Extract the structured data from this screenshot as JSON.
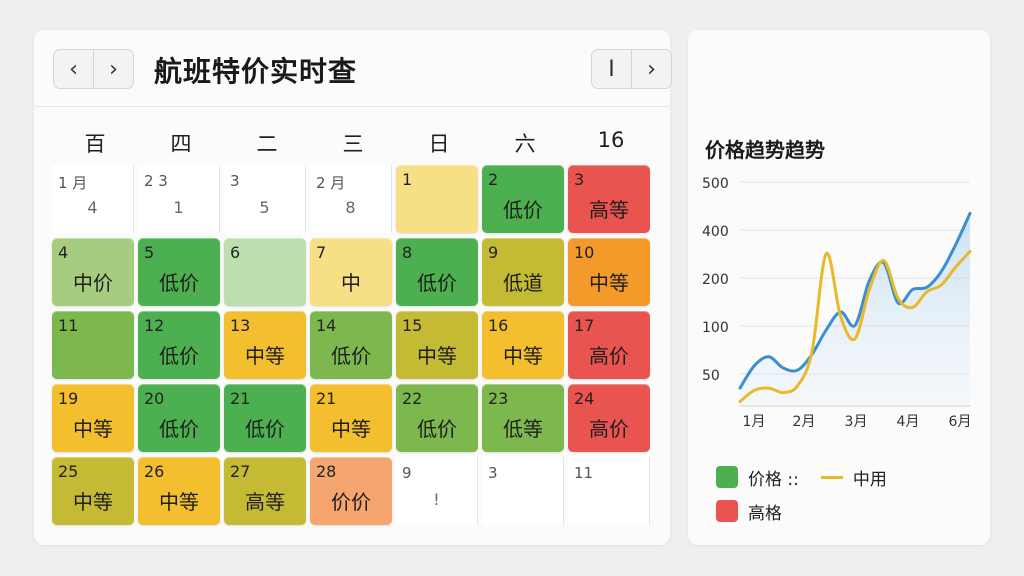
{
  "header": {
    "title": "航班特价实时查",
    "prev_glyph": "‹",
    "next_glyph": "›",
    "right_first_glyph": "I",
    "right_next_glyph": "›"
  },
  "weekdays": [
    "百",
    "四",
    "二",
    "三",
    "日",
    "六",
    "16"
  ],
  "calendar": {
    "rows": [
      [
        {
          "type": "blank",
          "num": "1   月",
          "sub": "4"
        },
        {
          "type": "blank",
          "num": "2   3",
          "sub": "1"
        },
        {
          "type": "blank",
          "num": "3",
          "sub": "5"
        },
        {
          "type": "blank",
          "num": "2   月",
          "sub": "8"
        },
        {
          "type": "cell",
          "num": "1",
          "label": "",
          "color": "paleyellow"
        },
        {
          "type": "cell",
          "num": "2",
          "label": "低价",
          "color": "green"
        },
        {
          "type": "cell",
          "num": "3",
          "label": "高等",
          "color": "red"
        }
      ],
      [
        {
          "type": "cell",
          "num": "4",
          "label": "中价",
          "color": "lightgreen"
        },
        {
          "type": "cell",
          "num": "5",
          "label": "低价",
          "color": "green"
        },
        {
          "type": "cell",
          "num": "6",
          "label": "",
          "color": "palegreen"
        },
        {
          "type": "cell",
          "num": "7",
          "label": "中",
          "color": "paleyellow"
        },
        {
          "type": "cell",
          "num": "8",
          "label": "低价",
          "color": "green"
        },
        {
          "type": "cell",
          "num": "9",
          "label": "低道",
          "color": "olive"
        },
        {
          "type": "cell",
          "num": "10",
          "label": "中等",
          "color": "orange"
        }
      ],
      [
        {
          "type": "cell",
          "num": "11",
          "label": "",
          "color": "mossgreen"
        },
        {
          "type": "cell",
          "num": "12",
          "label": "低价",
          "color": "green"
        },
        {
          "type": "cell",
          "num": "13",
          "label": "中等",
          "color": "yellow"
        },
        {
          "type": "cell",
          "num": "14",
          "label": "低价",
          "color": "mossgreen"
        },
        {
          "type": "cell",
          "num": "15",
          "label": "中等",
          "color": "olive"
        },
        {
          "type": "cell",
          "num": "16",
          "label": "中等",
          "color": "yellow"
        },
        {
          "type": "cell",
          "num": "17",
          "label": "高价",
          "color": "red"
        }
      ],
      [
        {
          "type": "cell",
          "num": "19",
          "label": "中等",
          "color": "yellow"
        },
        {
          "type": "cell",
          "num": "20",
          "label": "低价",
          "color": "green"
        },
        {
          "type": "cell",
          "num": "21",
          "label": "低价",
          "color": "green"
        },
        {
          "type": "cell",
          "num": "21",
          "label": "中等",
          "color": "yellow"
        },
        {
          "type": "cell",
          "num": "22",
          "label": "低价",
          "color": "mossgreen"
        },
        {
          "type": "cell",
          "num": "23",
          "label": "低等",
          "color": "mossgreen"
        },
        {
          "type": "cell",
          "num": "24",
          "label": "高价",
          "color": "red"
        }
      ],
      [
        {
          "type": "cell",
          "num": "25",
          "label": "中等",
          "color": "olive"
        },
        {
          "type": "cell",
          "num": "26",
          "label": "中等",
          "color": "yellow"
        },
        {
          "type": "cell",
          "num": "27",
          "label": "高等",
          "color": "olive"
        },
        {
          "type": "cell",
          "num": "28",
          "label": "价价",
          "color": "peach"
        },
        {
          "type": "blank",
          "num": "9",
          "sub": "!"
        },
        {
          "type": "blank",
          "num": "3",
          "sub": ""
        },
        {
          "type": "blank",
          "num": "11",
          "sub": ""
        }
      ]
    ]
  },
  "colors": {
    "lightgreen": "#a6cd7f",
    "green": "#4caf50",
    "mossgreen": "#7cb84e",
    "palegreen": "#bddfaf",
    "paleyellow": "#f7df86",
    "yellow": "#f4bf2f",
    "olive": "#c4ba34",
    "orange": "#f49a2a",
    "red": "#ea5450",
    "peach": "#f5a66e",
    "series_blue": "#3b8fd0",
    "series_yellow": "#e9b92a"
  },
  "chart_title": "价格趋势趋势",
  "chart_data": {
    "type": "line",
    "title": "价格趋势趋势",
    "y_ticks": [
      "500",
      "400",
      "200",
      "100",
      "50"
    ],
    "categories": [
      "1月",
      "2月",
      "3月",
      "4月",
      "6月"
    ],
    "x": [
      1,
      1.25,
      1.5,
      1.75,
      2,
      2.25,
      2.5,
      2.75,
      3,
      3.25,
      3.5,
      3.75,
      4,
      4.25,
      4.5,
      4.75,
      5
    ],
    "series": [
      {
        "values": [
          40,
          90,
          110,
          85,
          80,
          115,
          170,
          210,
          180,
          280,
          320,
          230,
          260,
          265,
          300,
          360,
          430
        ],
        "color": "blue"
      },
      {
        "values": [
          10,
          35,
          40,
          30,
          45,
          120,
          340,
          200,
          150,
          260,
          325,
          240,
          220,
          255,
          270,
          310,
          345
        ],
        "color": "yellow"
      }
    ],
    "ylim": [
      0,
      500
    ],
    "grid": true
  },
  "legend": {
    "item1_label": "价格 ::",
    "item1_color": "#4caf50",
    "item2_label": "中用",
    "item3_label": "高格",
    "item3_color": "#ea5450"
  }
}
